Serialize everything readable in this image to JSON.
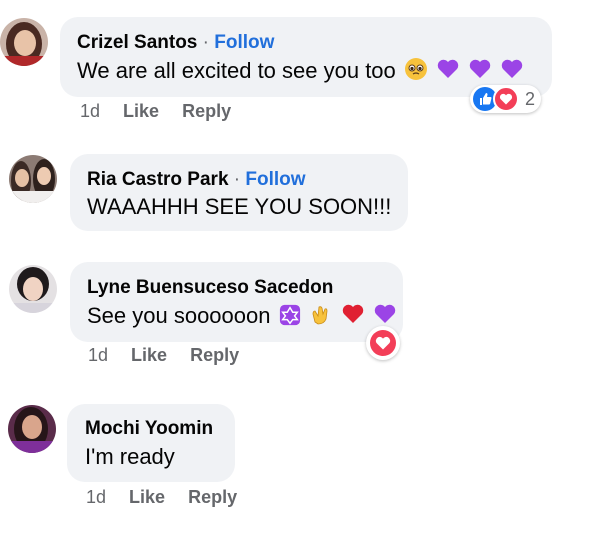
{
  "comments": [
    {
      "name": "Crizel Santos",
      "follow": "Follow",
      "text": "We are all excited to see you too",
      "time": "1d",
      "like": "Like",
      "reply": "Reply",
      "reaction_count": "2",
      "reactions": [
        "like-icon",
        "love-icon"
      ]
    },
    {
      "name": "Ria Castro Park",
      "follow": "Follow",
      "text": "WAAAHHH SEE YOU SOON!!!"
    },
    {
      "name": "Lyne Buensuceso Sacedon",
      "text": "See you soooooon",
      "time": "1d",
      "like": "Like",
      "reply": "Reply",
      "reactions": [
        "love-icon"
      ]
    },
    {
      "name": "Mochi Yoomin",
      "text": "I'm ready",
      "time": "1d",
      "like": "Like",
      "reply": "Reply"
    }
  ],
  "colors": {
    "bubble": "#f0f2f5",
    "follow": "#216fdb",
    "meta": "#65676b",
    "like_blue": "#1877f2",
    "love_red": "#f33e58",
    "purple_heart": "#9b44e6"
  },
  "separator": "·"
}
